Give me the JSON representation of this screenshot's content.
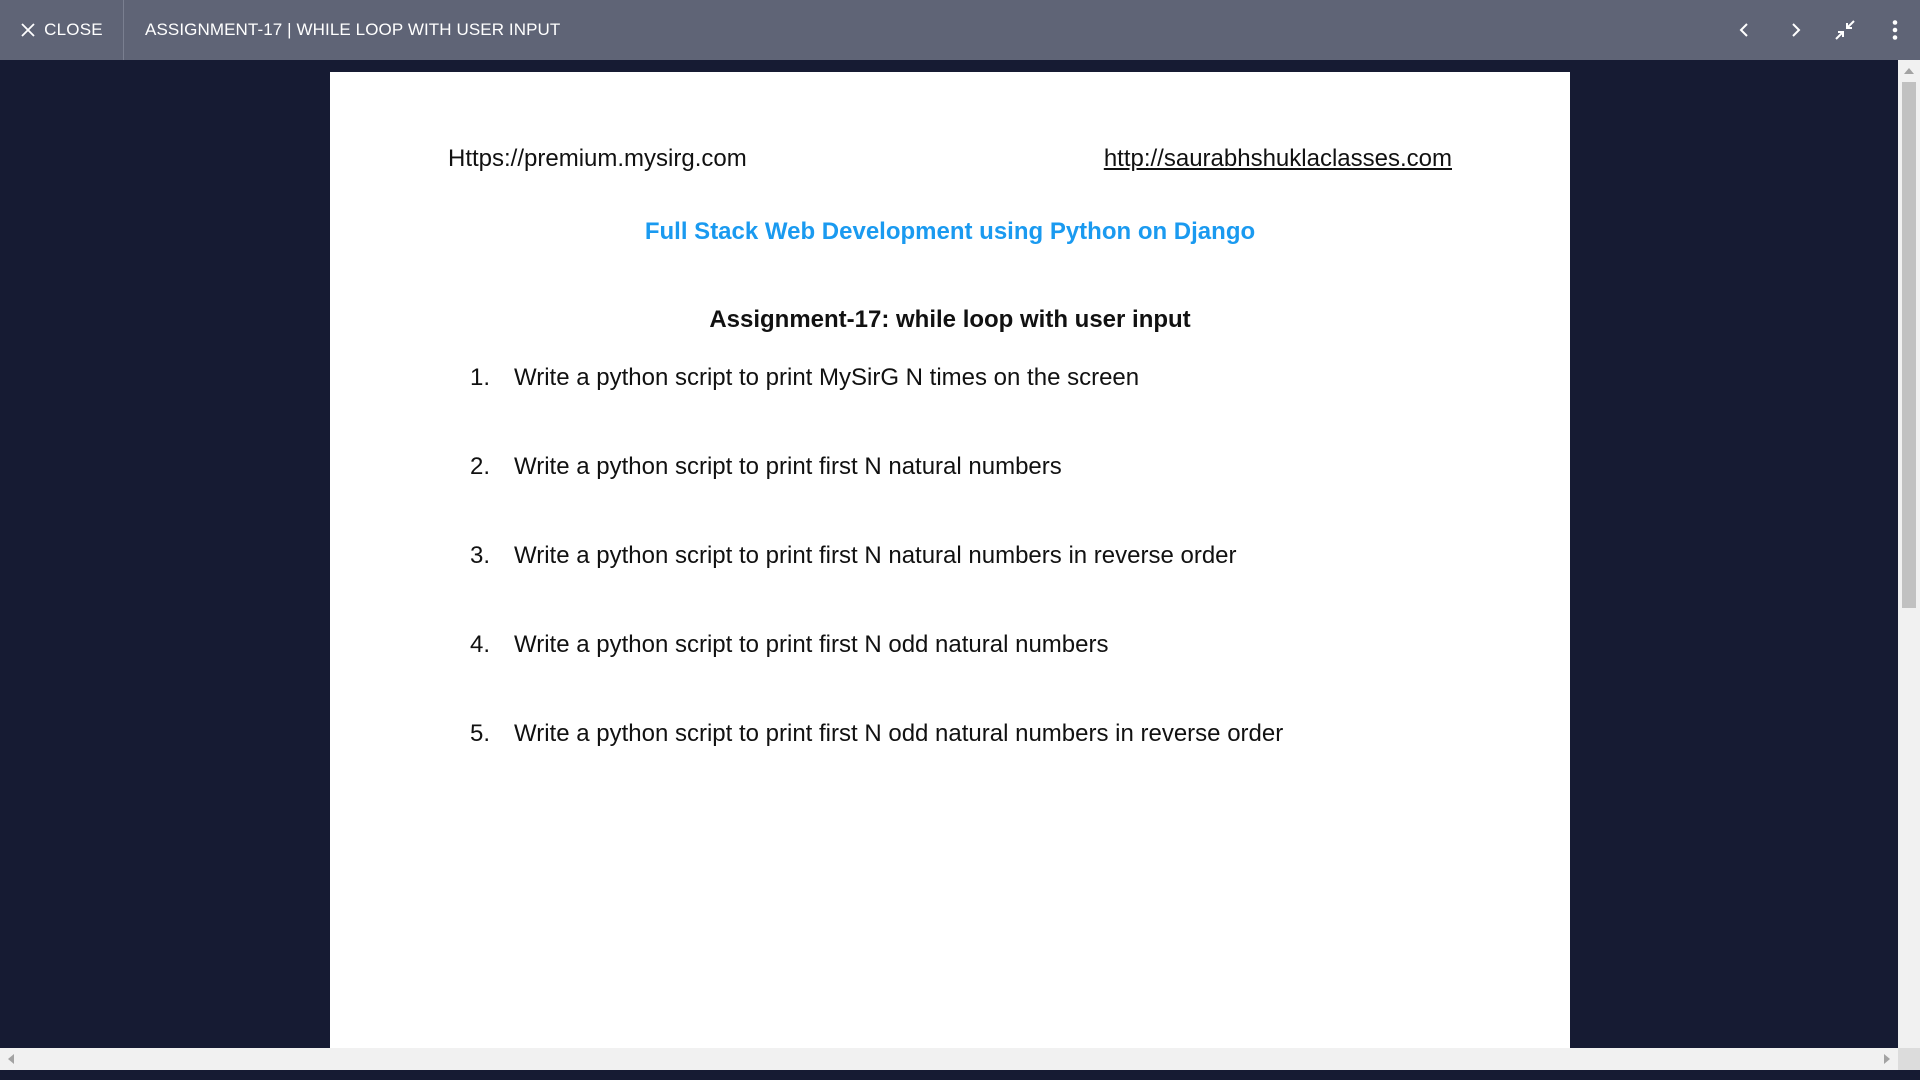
{
  "topbar": {
    "close_label": "CLOSE",
    "title": "ASSIGNMENT-17 | WHILE LOOP WITH USER INPUT",
    "icons": [
      "close-icon",
      "chevron-left-icon",
      "chevron-right-icon",
      "minimize-icon",
      "more-vertical-icon"
    ]
  },
  "document": {
    "left_link": "Https://premium.mysirg.com",
    "right_link": "http://saurabhshuklaclasses.com",
    "course_title": "Full Stack Web Development using Python on Django",
    "assignment_title": "Assignment-17: while loop with user input",
    "items": [
      {
        "num": "1.",
        "text": "Write a python script to print MySirG N times on the screen"
      },
      {
        "num": "2.",
        "text": "Write a python script to print first N natural numbers"
      },
      {
        "num": "3.",
        "text": "Write a python script to print first N natural numbers in reverse order"
      },
      {
        "num": "4.",
        "text": "Write a python script to print first N odd natural numbers"
      },
      {
        "num": "5.",
        "text": "Write a python script to print first N odd natural numbers in reverse order"
      }
    ]
  },
  "colors": {
    "topbar": "#5f6476",
    "background": "#161b33",
    "course_title": "#1a9af0"
  }
}
